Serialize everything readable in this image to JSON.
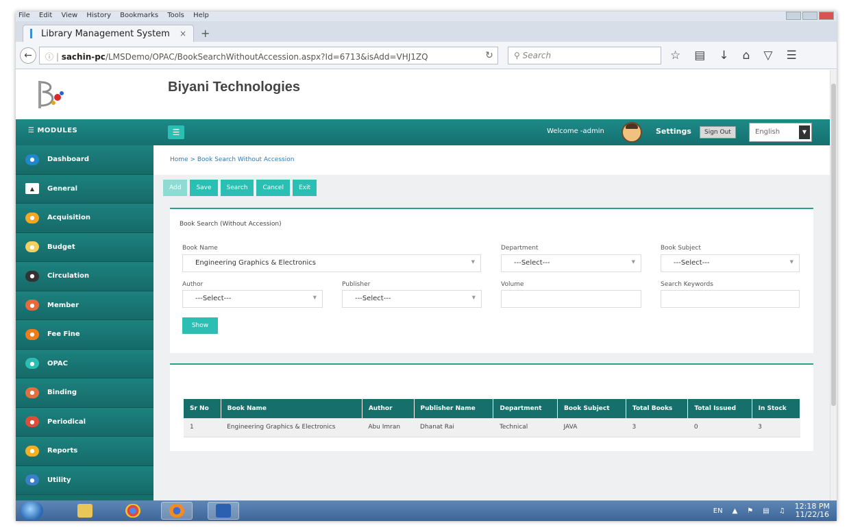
{
  "browser": {
    "menu": [
      "File",
      "Edit",
      "View",
      "History",
      "Bookmarks",
      "Tools",
      "Help"
    ],
    "tab_title": "Library Management System",
    "tab_close": "×",
    "new_tab": "+",
    "url_host": "sachin-pc",
    "url_path": "/LMSDemo/OPAC/BookSearchWithoutAccession.aspx?Id=6713&isAdd=VHJ1ZQ",
    "search_placeholder": "Search"
  },
  "header": {
    "brand": "Biyani Technologies",
    "modules_label": "MODULES",
    "welcome": "Welcome -admin",
    "settings": "Settings",
    "sign_out": "Sign Out",
    "language": "English"
  },
  "sidebar": {
    "items": [
      {
        "label": "Dashboard",
        "color": "#1e88c8"
      },
      {
        "label": "General",
        "color": "#ffffff"
      },
      {
        "label": "Acquisition",
        "color": "#f5a623"
      },
      {
        "label": "Budget",
        "color": "#f0d060"
      },
      {
        "label": "Circulation",
        "color": "#333333"
      },
      {
        "label": "Member",
        "color": "#e8693a"
      },
      {
        "label": "Fee Fine",
        "color": "#f07c1c"
      },
      {
        "label": "OPAC",
        "color": "#2bbfb4"
      },
      {
        "label": "Binding",
        "color": "#e07040"
      },
      {
        "label": "Periodical",
        "color": "#d94f3a"
      },
      {
        "label": "Reports",
        "color": "#f5b021"
      },
      {
        "label": "Utility",
        "color": "#3a7fc8"
      }
    ]
  },
  "breadcrumb": "Home > Book Search Without Accession",
  "toolbar": {
    "add": "Add",
    "save": "Save",
    "search": "Search",
    "cancel": "Cancel",
    "exit": "Exit"
  },
  "form": {
    "title": "Book Search (Without Accession)",
    "book_name_label": "Book Name",
    "book_name_value": "Engineering Graphics & Electronics",
    "department_label": "Department",
    "department_value": "---Select---",
    "book_subject_label": "Book Subject",
    "book_subject_value": "---Select---",
    "author_label": "Author",
    "author_value": "---Select---",
    "publisher_label": "Publisher",
    "publisher_value": "---Select---",
    "volume_label": "Volume",
    "volume_value": "",
    "keywords_label": "Search Keywords",
    "keywords_value": "",
    "show_button": "Show"
  },
  "results": {
    "columns": [
      "Sr No",
      "Book Name",
      "Author",
      "Publisher Name",
      "Department",
      "Book Subject",
      "Total Books",
      "Total Issued",
      "In Stock"
    ],
    "rows": [
      [
        "1",
        "Engineering Graphics & Electronics",
        "Abu Imran",
        "Dhanat Rai",
        "Technical",
        "JAVA",
        "3",
        "0",
        "3"
      ]
    ]
  },
  "taskbar": {
    "lang": "EN",
    "time": "12:18 PM",
    "date": "11/22/16"
  }
}
